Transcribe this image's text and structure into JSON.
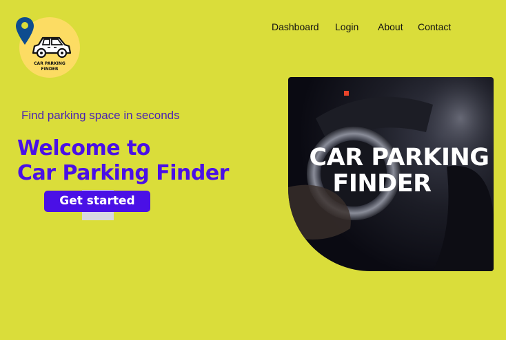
{
  "brand": {
    "logo_line1": "CAR PARKING",
    "logo_line2": "FINDER"
  },
  "nav": {
    "items": [
      {
        "label": "Dashboard"
      },
      {
        "label": "Login"
      },
      {
        "label": "About"
      },
      {
        "label": "Contact"
      }
    ]
  },
  "hero": {
    "tagline": "Find parking space in seconds",
    "headline_line1": "Welcome to",
    "headline_line2": "Car Parking Finder",
    "cta_label": "Get started",
    "image_title_line1": "CAR PARKING",
    "image_title_line2": "FINDER"
  },
  "colors": {
    "background": "#dadd3a",
    "accent": "#4a10e6",
    "logo_bg": "#fcdc63",
    "pin": "#0e4c8f"
  },
  "icons": {
    "pin": "location-pin-icon",
    "car": "car-icon"
  }
}
